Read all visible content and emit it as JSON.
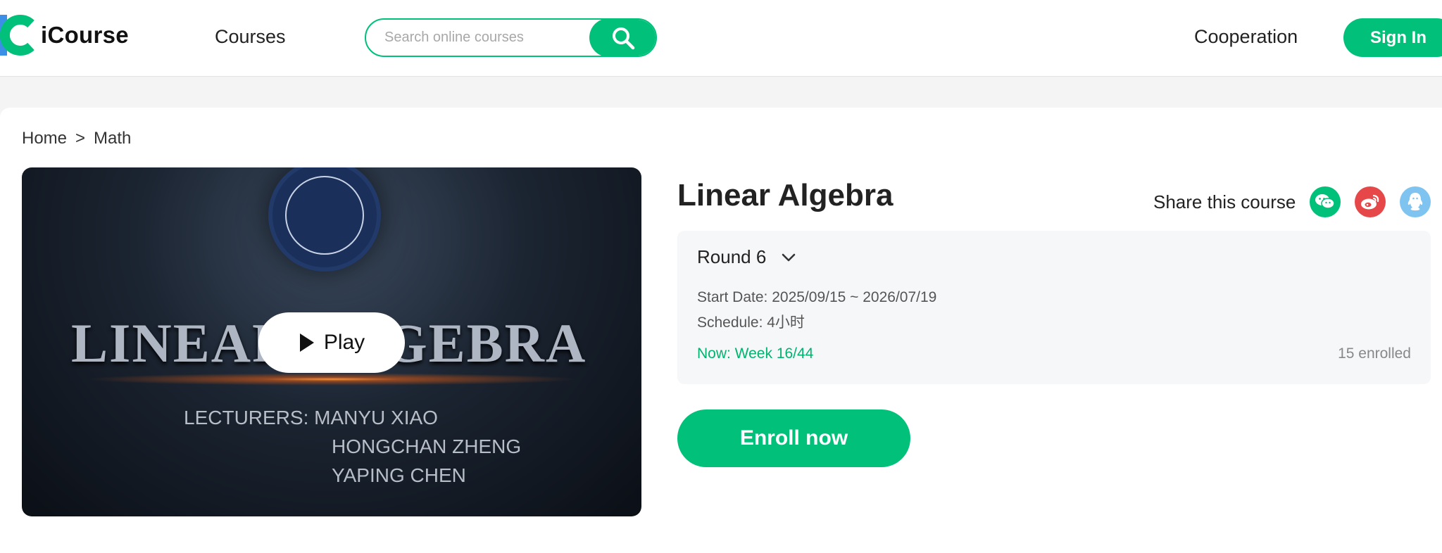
{
  "header": {
    "logo_text": "iCourse",
    "nav_courses": "Courses",
    "search_placeholder": "Search online courses",
    "nav_cooperation": "Cooperation",
    "signin_label": "Sign In"
  },
  "breadcrumb": {
    "home": "Home",
    "sep": ">",
    "current": "Math"
  },
  "video": {
    "cover_title": "LINEAR ALGEBRA",
    "lecturers_line1": "LECTURERS: MANYU XIAO",
    "lecturers_line2": "HONGCHAN ZHENG",
    "lecturers_line3": "YAPING CHEN",
    "play_label": "Play"
  },
  "course": {
    "title": "Linear Algebra",
    "share_label": "Share this course",
    "round_label": "Round 6",
    "start_date": "Start Date: 2025/09/15 ~ 2026/07/19",
    "schedule": "Schedule: 4小时",
    "now": "Now: Week 16/44",
    "enrolled": "15 enrolled",
    "enroll_label": "Enroll now"
  },
  "colors": {
    "accent": "#00c07a",
    "weibo": "#e6484a",
    "qq": "#7fc4f0",
    "logo_blue": "#3b8fe6"
  },
  "icons": [
    "search-icon",
    "play-icon",
    "chevron-down-icon",
    "wechat-icon",
    "weibo-icon",
    "qq-icon"
  ]
}
